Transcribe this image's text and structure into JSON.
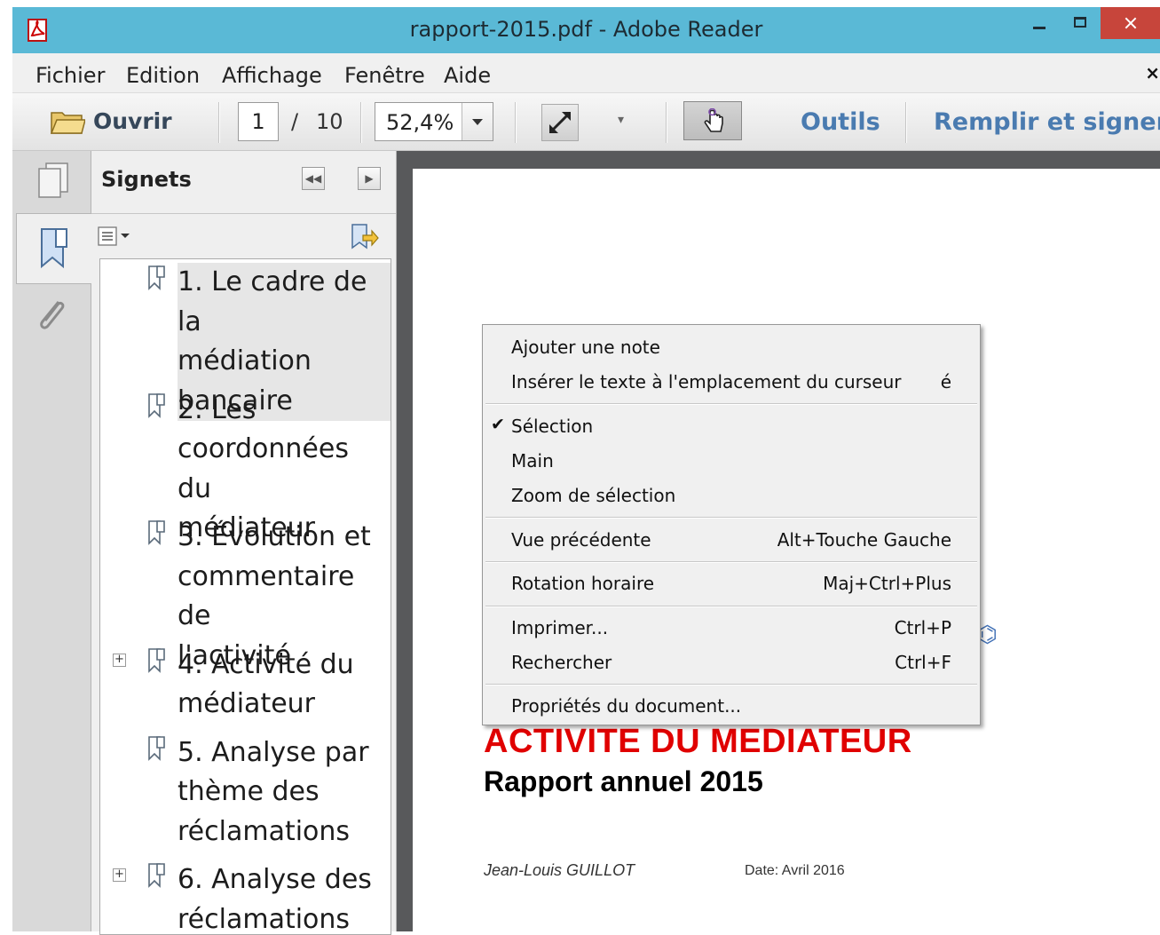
{
  "window": {
    "title": "rapport-2015.pdf - Adobe Reader"
  },
  "menubar": {
    "items": [
      "Fichier",
      "Edition",
      "Affichage",
      "Fenêtre",
      "Aide"
    ],
    "close": "×"
  },
  "toolbar": {
    "open_label": "Ouvrir",
    "page_current": "1",
    "page_separator": "/",
    "page_total": "10",
    "zoom": "52,4%",
    "tools_label": "Outils",
    "fill_sign_label": "Remplir et signer"
  },
  "bookmarks": {
    "title": "Signets",
    "items": [
      {
        "lines": [
          "1. Le cadre de la",
          "médiation",
          "bancaire"
        ],
        "expandable": false,
        "selected": true
      },
      {
        "lines": [
          "2. Les",
          "coordonnées du",
          "médiateur"
        ],
        "expandable": false,
        "selected": false
      },
      {
        "lines": [
          "3. Évolution et",
          "commentaire de",
          "l'activité"
        ],
        "expandable": false,
        "selected": false
      },
      {
        "lines": [
          "4. Activité du",
          "médiateur"
        ],
        "expandable": true,
        "selected": false
      },
      {
        "lines": [
          "5. Analyse par",
          "thème des",
          "réclamations"
        ],
        "expandable": false,
        "selected": false
      },
      {
        "lines": [
          "6. Analyse des",
          "réclamations"
        ],
        "expandable": true,
        "selected": false
      }
    ]
  },
  "document": {
    "heading": "ACTIVITE DU MEDIATEUR",
    "subheading": "Rapport annuel 2015",
    "author": "Jean-Louis GUILLOT",
    "date": "Date: Avril 2016"
  },
  "context_menu": {
    "add_note": "Ajouter une note",
    "insert_text": "Insérer le texte à l'emplacement du curseur",
    "insert_text_shortcut": "é",
    "selection": "Sélection",
    "hand": "Main",
    "zoom_selection": "Zoom de sélection",
    "previous_view": "Vue précédente",
    "previous_view_shortcut": "Alt+Touche Gauche",
    "rotate": "Rotation horaire",
    "rotate_shortcut": "Maj+Ctrl+Plus",
    "print": "Imprimer...",
    "print_shortcut": "Ctrl+P",
    "search": "Rechercher",
    "search_shortcut": "Ctrl+F",
    "properties": "Propriétés du document..."
  },
  "colors": {
    "titlebar": "#5ab9d6",
    "close_button": "#c7453b",
    "accent_text": "#4a7bb0",
    "heading_red": "#e00000"
  }
}
